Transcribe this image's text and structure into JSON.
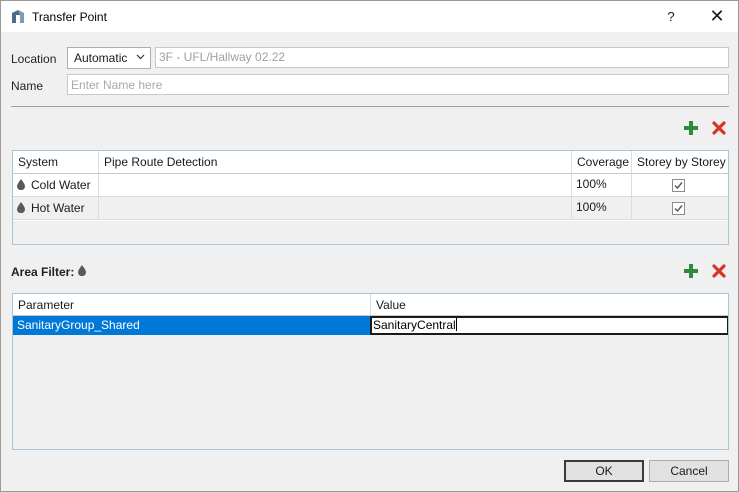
{
  "window": {
    "title": "Transfer Point",
    "help_label": "?",
    "close_label": "✕"
  },
  "location": {
    "label": "Location",
    "mode": "Automatic",
    "value": "3F - UFL/Hallway 02.22"
  },
  "name": {
    "label": "Name",
    "placeholder": "Enter Name here"
  },
  "systems_table": {
    "columns": [
      "System",
      "Pipe Route Detection",
      "Coverage",
      "Storey by Storey"
    ],
    "rows": [
      {
        "system": "Cold Water",
        "pipe_route": "",
        "coverage": "100%",
        "storey_by_storey": true
      },
      {
        "system": "Hot Water",
        "pipe_route": "",
        "coverage": "100%",
        "storey_by_storey": true
      }
    ]
  },
  "area_filter": {
    "label": "Area Filter:",
    "columns": [
      "Parameter",
      "Value"
    ],
    "rows": [
      {
        "parameter": "SanitaryGroup_Shared",
        "value": "SanitaryCentral"
      }
    ]
  },
  "buttons": {
    "ok": "OK",
    "cancel": "Cancel"
  },
  "colors": {
    "accent": "#0078d7",
    "add": "#2e8b3e",
    "remove": "#d9342b"
  },
  "icons": {
    "add": "plus-icon",
    "remove": "delete-x-icon",
    "system": "water-drop-icon"
  }
}
